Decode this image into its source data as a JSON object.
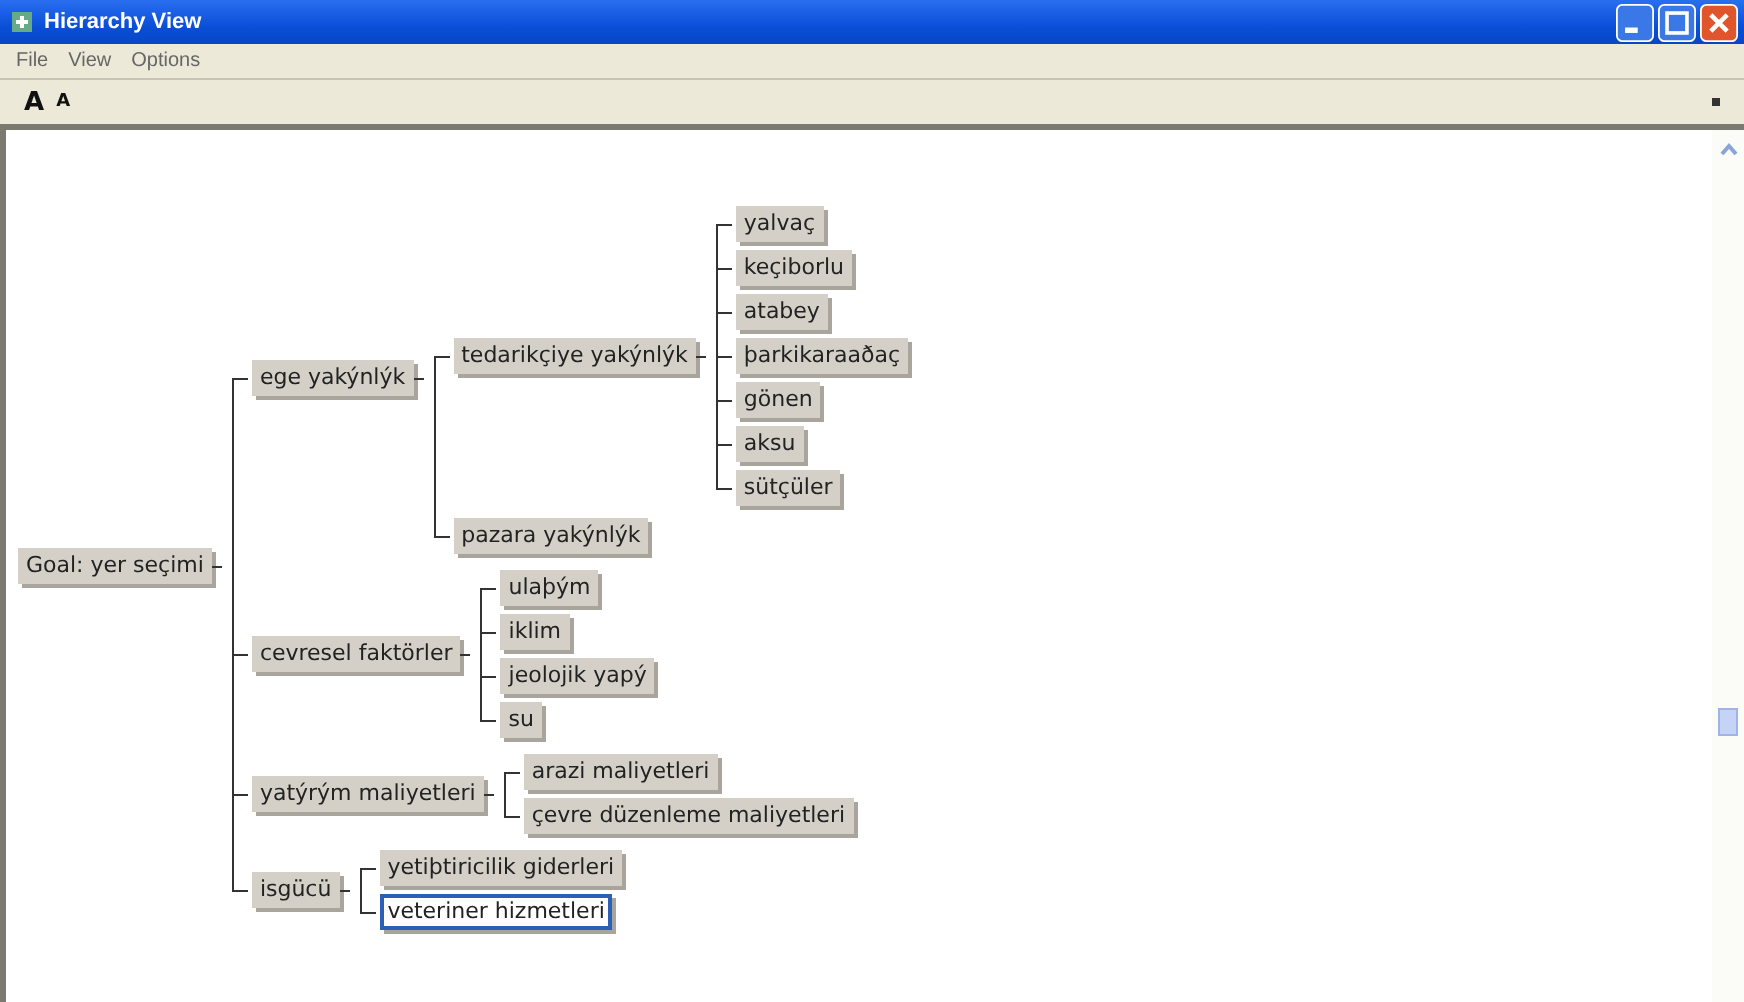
{
  "window": {
    "title": "Hierarchy View"
  },
  "menu": [
    "File",
    "View",
    "Options"
  ],
  "toolbar": [
    {
      "label": "A",
      "kind": "grow"
    },
    {
      "label": "A",
      "kind": "shrink"
    }
  ],
  "tree": {
    "label": "Goal: yer seçimi",
    "selected": false,
    "children": [
      {
        "label": "ege yakýnlýk",
        "selected": false,
        "children": [
          {
            "label": "tedarikçiye yakýnlýk",
            "selected": false,
            "children": [
              {
                "label": "yalvaç",
                "selected": false
              },
              {
                "label": "keçiborlu",
                "selected": false
              },
              {
                "label": "atabey",
                "selected": false
              },
              {
                "label": "þarkikaraaðaç",
                "selected": false
              },
              {
                "label": "gönen",
                "selected": false
              },
              {
                "label": "aksu",
                "selected": false
              },
              {
                "label": "sütçüler",
                "selected": false
              }
            ]
          },
          {
            "label": "pazara yakýnlýk",
            "selected": false
          }
        ]
      },
      {
        "label": "cevresel faktörler",
        "selected": false,
        "children": [
          {
            "label": "ulaþým",
            "selected": false
          },
          {
            "label": "iklim",
            "selected": false
          },
          {
            "label": "jeolojik yapý",
            "selected": false
          },
          {
            "label": "su",
            "selected": false
          }
        ]
      },
      {
        "label": "yatýrým maliyetleri",
        "selected": false,
        "children": [
          {
            "label": "arazi maliyetleri",
            "selected": false
          },
          {
            "label": "çevre düzenleme maliyetleri",
            "selected": false
          }
        ]
      },
      {
        "label": "isgücü",
        "selected": false,
        "children": [
          {
            "label": "yetiþtiricilik giderleri",
            "selected": false
          },
          {
            "label": "veteriner hizmetleri",
            "selected": true
          }
        ]
      }
    ]
  }
}
